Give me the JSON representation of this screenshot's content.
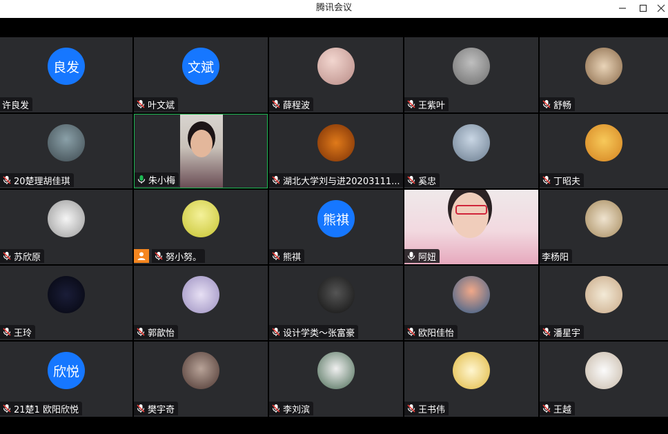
{
  "window": {
    "title": "腾讯会议",
    "controls": [
      "minimize-icon",
      "maximize-icon",
      "close-icon"
    ]
  },
  "participants": [
    {
      "name": "许良发",
      "avatar_text": "良发",
      "mic": "none"
    },
    {
      "name": "叶文斌",
      "avatar_text": "文斌",
      "mic": "muted"
    },
    {
      "name": "薛程波",
      "avatar_text": "",
      "mic": "muted"
    },
    {
      "name": "王紫叶",
      "avatar_text": "",
      "mic": "muted"
    },
    {
      "name": "舒畅",
      "avatar_text": "",
      "mic": "muted"
    },
    {
      "name": "20楚理胡佳琪",
      "avatar_text": "",
      "mic": "muted"
    },
    {
      "name": "朱小梅",
      "avatar_text": "",
      "mic": "active"
    },
    {
      "name": "湖北大学刘与进20203111...",
      "avatar_text": "",
      "mic": "muted"
    },
    {
      "name": "奚忠",
      "avatar_text": "",
      "mic": "muted"
    },
    {
      "name": "丁昭夫",
      "avatar_text": "",
      "mic": "muted"
    },
    {
      "name": "苏欣原",
      "avatar_text": "",
      "mic": "muted"
    },
    {
      "name": "努小努。",
      "avatar_text": "",
      "mic": "muted"
    },
    {
      "name": "熊祺",
      "avatar_text": "熊祺",
      "mic": "muted"
    },
    {
      "name": "阿妞",
      "avatar_text": "",
      "mic": "on"
    },
    {
      "name": "李杨阳",
      "avatar_text": "",
      "mic": "none"
    },
    {
      "name": "王玲",
      "avatar_text": "",
      "mic": "muted"
    },
    {
      "name": "郭歆怡",
      "avatar_text": "",
      "mic": "muted"
    },
    {
      "name": "设计学类～张富豪",
      "avatar_text": "",
      "mic": "muted"
    },
    {
      "name": "欧阳佳怡",
      "avatar_text": "",
      "mic": "muted"
    },
    {
      "name": "潘星宇",
      "avatar_text": "",
      "mic": "muted"
    },
    {
      "name": "21楚1 欧阳欣悦",
      "avatar_text": "欣悦",
      "mic": "muted"
    },
    {
      "name": "樊宇奇",
      "avatar_text": "",
      "mic": "muted"
    },
    {
      "name": "李刘滨",
      "avatar_text": "",
      "mic": "muted"
    },
    {
      "name": "王书伟",
      "avatar_text": "",
      "mic": "muted"
    },
    {
      "name": "王越",
      "avatar_text": "",
      "mic": "muted"
    }
  ],
  "colors": {
    "tile_bg": "#2a2b2e",
    "avatar_blue": "#1677ff",
    "active_green": "#1db954",
    "muted_red": "#e53935"
  }
}
